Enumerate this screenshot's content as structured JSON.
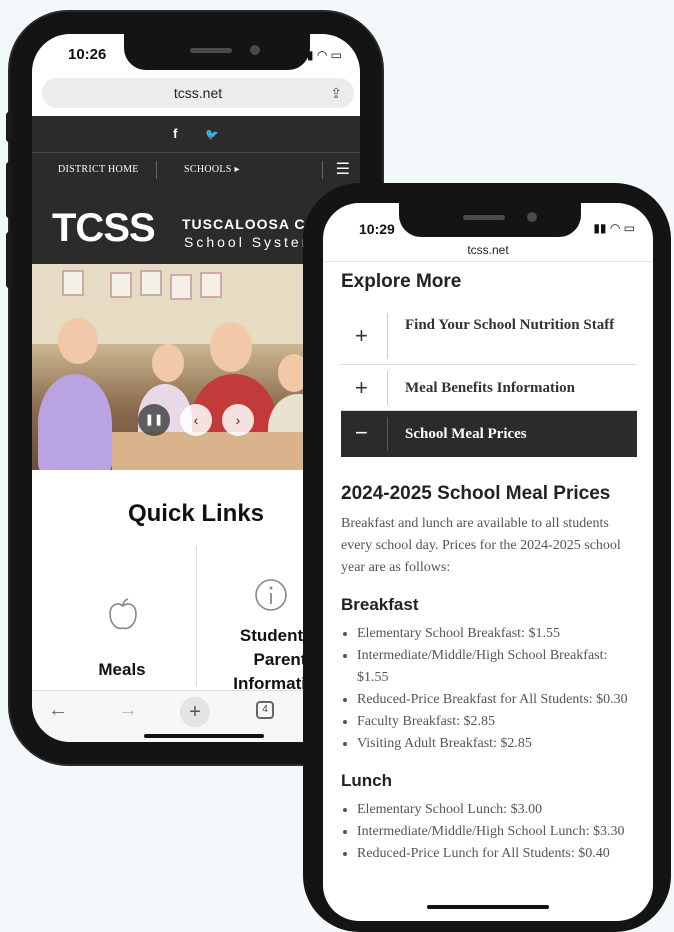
{
  "phone_back": {
    "time": "10:26",
    "url": "tcss.net",
    "social": [
      "f",
      "🐦"
    ],
    "nav": {
      "district_home": "DISTRICT HOME",
      "schools": "SCHOOLS ▸"
    },
    "logo": {
      "mark": "TCSS",
      "org_line1": "TUSCALOOSA COUNTY",
      "org_line2": "School System"
    },
    "quick_links_title": "Quick Links",
    "links": [
      {
        "label": "Meals",
        "icon": "apple-icon"
      },
      {
        "label": "Student & Parent Information",
        "icon": "info-icon"
      }
    ],
    "link_label_lines": [
      "Student &",
      "Parent",
      "Information"
    ],
    "tab_count": "4"
  },
  "phone_front": {
    "time": "10:29",
    "url": "tcss.net",
    "explore_title": "Explore More",
    "accordion": [
      {
        "label": "Find Your School Nutrition Staff",
        "expanded": false
      },
      {
        "label": "Meal Benefits Information",
        "expanded": false
      },
      {
        "label": "School Meal Prices",
        "expanded": true
      }
    ],
    "section_title": "2024-2025 School Meal Prices",
    "intro": "Breakfast and lunch are available to all students every school day. Prices for the 2024-2025 school year are as follows:",
    "breakfast_title": "Breakfast",
    "breakfast": [
      "Elementary School Breakfast: $1.55",
      "Intermediate/Middle/High School Breakfast: $1.55",
      "Reduced-Price Breakfast for All Students: $0.30",
      "Faculty Breakfast: $2.85",
      "Visiting Adult Breakfast: $2.85"
    ],
    "lunch_title": "Lunch",
    "lunch": [
      "Elementary School Lunch: $3.00",
      "Intermediate/Middle/High School Lunch: $3.30",
      "Reduced-Price Lunch for All Students: $0.40"
    ]
  },
  "colors": {
    "dark_band": "#2b2b2b",
    "frame": "#141414",
    "background": "#f3f9fb"
  }
}
